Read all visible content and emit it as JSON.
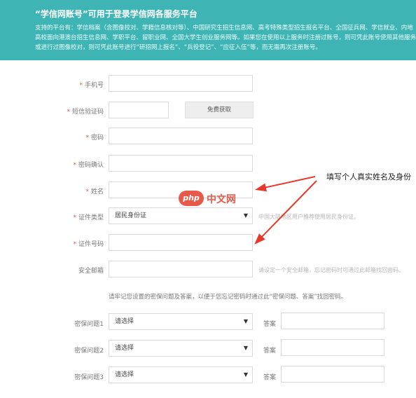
{
  "banner": {
    "title": "“学信网账号”可用于登录学信网各服务平台",
    "desc_lines": [
      "支持的平台有：学信档案（含图像校对、学籍信息核对等）、中国研究生招生信息网、高考特殊类型招生报名平台、全国征兵网、学信就业、内地",
      "高校面向港澳台招生信息网、学职平台、留职业网、全国大学生创业服务网等。如果您在使用以上服务时注册过账号，则可凭此账号使用其他服务",
      "或进行过图像校对，则可凭此账号进行“研招网上报名”、“兵役登记”、“应征入伍”等，而无需再次注册账号。"
    ]
  },
  "form": {
    "phone_label": "手机号",
    "sms_label": "短信验证码",
    "sms_button": "免费获取",
    "password_label": "密码",
    "password_confirm_label": "密码确认",
    "name_label": "姓名",
    "id_type_label": "证件类型",
    "id_type_value": "居民身份证",
    "id_type_hint": "中国大陆地区用户推荐使用居民身份证。",
    "id_number_label": "证件号码",
    "email_label": "安全邮箱",
    "email_hint": "请设定一个安全邮箱，忘记密码时可通过此邮箱找回密码。",
    "security_note": "请牢记您设置的密保问题及答案，以便于您忘记密码时通过此“密保问题、答案”找回密码。",
    "questions": [
      {
        "label": "密保问题1",
        "select_value": "请选择",
        "answer_label": "答案"
      },
      {
        "label": "密保问题2",
        "select_value": "请选择",
        "answer_label": "答案"
      },
      {
        "label": "密保问题3",
        "select_value": "请选择",
        "answer_label": "答案"
      }
    ],
    "required_mark": "*"
  },
  "annotation": {
    "text": "填写个人真实姓名及身份"
  },
  "watermark": {
    "logo": "php",
    "text": "中文网"
  }
}
